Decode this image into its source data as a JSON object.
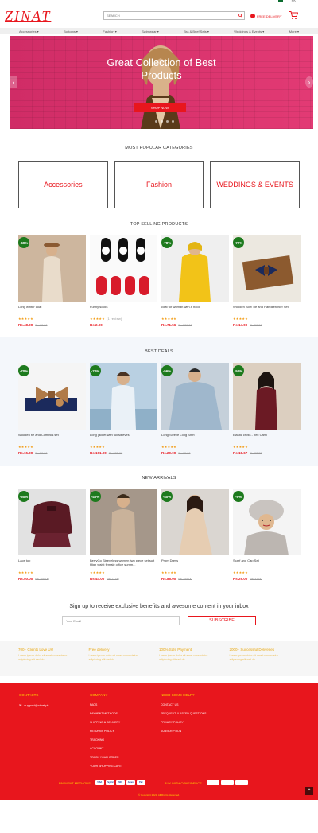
{
  "topbar": {
    "language": "PK"
  },
  "header": {
    "logo": "ZINAT",
    "search_placeholder": "SEARCH",
    "free_delivery": "FREE DELIVERY",
    "nav": [
      "Accessories",
      "Bottoms",
      "Fashion",
      "Swimwear",
      "Bra & Brief Sets",
      "Weddings & Events",
      "More"
    ]
  },
  "hero": {
    "title_line1": "Great Collection of Best",
    "title_line2": "Products",
    "button": "SHOP NOW",
    "slide_count": 4
  },
  "categories": {
    "title": "MOST POPULAR CATEGORIES",
    "items": [
      "Accessories",
      "Fashion",
      "WEDDINGS & EVENTS"
    ]
  },
  "top_selling": {
    "title": "TOP SELLING PRODUCTS",
    "items": [
      {
        "badge": "-40%",
        "name": "Long winter coat",
        "price": "Rs.48.00",
        "old": "Rs.80.00",
        "stars": "★★★★★",
        "reviews": ""
      },
      {
        "badge": "",
        "name": "Funny socks",
        "price": "Rs.2.00",
        "old": "",
        "stars": "★★★★★",
        "reviews": "(1 review)"
      },
      {
        "badge": "-78%",
        "name": "coat for woman with a hood",
        "price": "Rs.71.56",
        "old": "Rs.326.00",
        "stars": "★★★★★",
        "reviews": ""
      },
      {
        "badge": "-72%",
        "name": "Wooden Bow Tie and Handkerchief Set",
        "price": "Rs.14.00",
        "old": "Rs.50.00",
        "stars": "★★★★★",
        "reviews": ""
      }
    ]
  },
  "best_deals": {
    "title": "BEST DEALS",
    "items": [
      {
        "badge": "-70%",
        "name": "Wooden tie and Cufflinks set",
        "price": "Rs.15.00",
        "old": "Rs.50.00",
        "stars": "★★★★★"
      },
      {
        "badge": "-70%",
        "name": "Long jacket with full sleeves",
        "price": "Rs.101.00",
        "old": "Rs.335.00",
        "stars": "★★★★★"
      },
      {
        "badge": "-56%",
        "name": "Long Sleeve Long Shirt",
        "price": "Rs.29.00",
        "old": "Rs.65.00",
        "stars": "★★★★★"
      },
      {
        "badge": "-50%",
        "name": "Elastic cross - belt Cami",
        "price": "Rs.18.67",
        "old": "Rs.37.33",
        "stars": "★★★★★"
      }
    ]
  },
  "new_arrivals": {
    "title": "NEW ARRIVALS",
    "items": [
      {
        "badge": "-50%",
        "name": "Lace top",
        "price": "Rs.50.00",
        "old": "Rs.100.00",
        "stars": "★★★★★"
      },
      {
        "badge": "-40%",
        "name": "BerryGo Sleeveless women two piece set suit High waist female office summ...",
        "price": "Rs.44.00",
        "old": "Rs.73.00",
        "stars": "★★★★★"
      },
      {
        "badge": "-40%",
        "name": "Prom Dress",
        "price": "Rs.86.00",
        "old": "Rs.144.00",
        "stars": "★★★★★"
      },
      {
        "badge": "-9%",
        "name": "Scarf and Cap Set",
        "price": "Rs.29.00",
        "old": "Rs.32.00",
        "stars": "★★★★★"
      }
    ]
  },
  "newsletter": {
    "text": "Sign up to receive exclusive benefits and awesome content in your inbox",
    "placeholder": "Your Email",
    "button": "SUBSCRIBE"
  },
  "features": [
    {
      "title": "700+ Clients Love Us!",
      "text": "Lorem ipsum dolor sit amet consectetur adipiscing elit sed do"
    },
    {
      "title": "Free delivery",
      "text": "Lorem ipsum dolor sit amet consectetur adipiscing elit sed do"
    },
    {
      "title": "100% Safe Payment",
      "text": "Lorem ipsum dolor sit amet consectetur adipiscing elit sed do"
    },
    {
      "title": "2000+ Successful Deliveries",
      "text": "Lorem ipsum dolor sit amet consectetur adipiscing elit sed do"
    }
  ],
  "footer": {
    "contacts_title": "CONTACTS",
    "email": "support@zinat.pk",
    "company_title": "COMPANY",
    "company_links": [
      "FAQS",
      "PAYMENT METHODS",
      "SHIPPING & DELIVERY",
      "RETURNS POLICY",
      "TRACKING",
      "ACCOUNT",
      "TRACK YOUR ORDER",
      "YOUR SHOPPING CART"
    ],
    "help_title": "NEED SOME HELP?",
    "help_links": [
      "CONTACT US",
      "FREQUENTLY ASKED QUESTIONS",
      "PRIVACY POLICY",
      "SUBSCRIPTION"
    ],
    "payment_label": "PAYMENT METHODS",
    "payment_methods": [
      "VISA",
      "PayPal",
      "MC",
      "Amex",
      "Pay"
    ],
    "buy_label": "BUY WITH CONFIDENCE",
    "copyright": "© Copyright 2021. All Rights Reserved."
  },
  "colors": {
    "brand": "#e8161d",
    "badge": "#1d7a1d",
    "accent": "#ffd400"
  }
}
